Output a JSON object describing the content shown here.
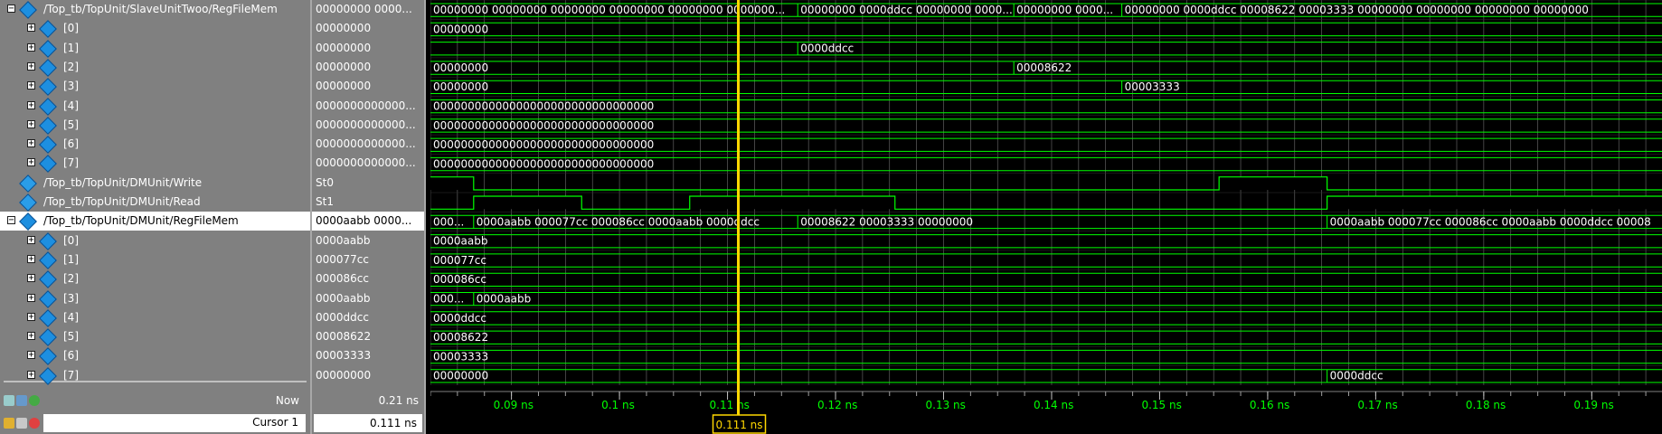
{
  "signals": [
    {
      "name": "/Top_tb/TopUnit/SlaveUnitTwoo/RegFileMem",
      "value": "00000000 0000...",
      "expand": "−",
      "indent": 0,
      "icon": "memory-diamond-icon"
    },
    {
      "name": "[0]",
      "value": "00000000",
      "expand": "+",
      "indent": 1,
      "icon": "diamond-icon"
    },
    {
      "name": "[1]",
      "value": "00000000",
      "expand": "+",
      "indent": 1,
      "icon": "diamond-icon"
    },
    {
      "name": "[2]",
      "value": "00000000",
      "expand": "+",
      "indent": 1,
      "icon": "diamond-icon"
    },
    {
      "name": "[3]",
      "value": "00000000",
      "expand": "+",
      "indent": 1,
      "icon": "diamond-icon"
    },
    {
      "name": "[4]",
      "value": "0000000000000...",
      "expand": "+",
      "indent": 1,
      "icon": "diamond-icon"
    },
    {
      "name": "[5]",
      "value": "0000000000000...",
      "expand": "+",
      "indent": 1,
      "icon": "diamond-icon"
    },
    {
      "name": "[6]",
      "value": "0000000000000...",
      "expand": "+",
      "indent": 1,
      "icon": "diamond-icon"
    },
    {
      "name": "[7]",
      "value": "0000000000000...",
      "expand": "+",
      "indent": 1,
      "icon": "diamond-icon"
    },
    {
      "name": "/Top_tb/TopUnit/DMUnit/Write",
      "value": "St0",
      "expand": "",
      "indent": 0,
      "icon": "signal-icon"
    },
    {
      "name": "/Top_tb/TopUnit/DMUnit/Read",
      "value": "St1",
      "expand": "",
      "indent": 0,
      "icon": "signal-icon"
    },
    {
      "name": "/Top_tb/TopUnit/DMUnit/RegFileMem",
      "value": "0000aabb 0000...",
      "expand": "−",
      "indent": 0,
      "icon": "memory-diamond-icon",
      "selected": true
    },
    {
      "name": "[0]",
      "value": "0000aabb",
      "expand": "+",
      "indent": 1,
      "icon": "diamond-icon"
    },
    {
      "name": "[1]",
      "value": "000077cc",
      "expand": "+",
      "indent": 1,
      "icon": "diamond-icon"
    },
    {
      "name": "[2]",
      "value": "000086cc",
      "expand": "+",
      "indent": 1,
      "icon": "diamond-icon"
    },
    {
      "name": "[3]",
      "value": "0000aabb",
      "expand": "+",
      "indent": 1,
      "icon": "diamond-icon"
    },
    {
      "name": "[4]",
      "value": "0000ddcc",
      "expand": "+",
      "indent": 1,
      "icon": "diamond-icon"
    },
    {
      "name": "[5]",
      "value": "00008622",
      "expand": "+",
      "indent": 1,
      "icon": "diamond-icon"
    },
    {
      "name": "[6]",
      "value": "00003333",
      "expand": "+",
      "indent": 1,
      "icon": "diamond-icon"
    },
    {
      "name": "[7]",
      "value": "00000000",
      "expand": "+",
      "indent": 1,
      "icon": "diamond-icon"
    }
  ],
  "status": {
    "now_label": "Now",
    "now_value": "0.21 ns",
    "cursor_label": "Cursor 1",
    "cursor_value": "0.111 ns"
  },
  "timeline": {
    "start_ns": 0.0825,
    "end_ns": 0.1965,
    "ticks_ns": [
      0.09,
      0.1,
      0.11,
      0.12,
      0.13,
      0.14,
      0.15,
      0.16,
      0.17,
      0.18,
      0.19
    ],
    "tick_labels": [
      "0.09 ns",
      "0.1 ns",
      "0.11 ns",
      "0.12 ns",
      "0.13 ns",
      "0.14 ns",
      "0.15 ns",
      "0.16 ns",
      "0.17 ns",
      "0.18 ns",
      "0.19 ns"
    ],
    "cursor_ns": 0.111,
    "cursor_label": "0.111 ns"
  },
  "waves": [
    {
      "type": "bus",
      "segments": [
        {
          "t0": 0.0825,
          "t1": 0.1165,
          "text": "00000000 00000000 00000000 00000000 00000000 0000000..."
        },
        {
          "t0": 0.1165,
          "t1": 0.1365,
          "text": "00000000 0000ddcc 00000000 0000..."
        },
        {
          "t0": 0.1365,
          "t1": 0.1465,
          "text": "00000000 0000..."
        },
        {
          "t0": 0.1465,
          "t1": 0.1965,
          "text": "00000000 0000ddcc 00008622 00003333 00000000 00000000 00000000 00000000"
        }
      ]
    },
    {
      "type": "bus",
      "segments": [
        {
          "t0": 0.0825,
          "t1": 0.1965,
          "text": "00000000"
        }
      ]
    },
    {
      "type": "bus",
      "segments": [
        {
          "t0": 0.0825,
          "t1": 0.1165,
          "text": ""
        },
        {
          "t0": 0.1165,
          "t1": 0.1965,
          "text": "0000ddcc"
        }
      ]
    },
    {
      "type": "bus",
      "segments": [
        {
          "t0": 0.0825,
          "t1": 0.1365,
          "text": "00000000"
        },
        {
          "t0": 0.1365,
          "t1": 0.1965,
          "text": "00008622"
        }
      ]
    },
    {
      "type": "bus",
      "segments": [
        {
          "t0": 0.0825,
          "t1": 0.1465,
          "text": "00000000"
        },
        {
          "t0": 0.1465,
          "t1": 0.1965,
          "text": "00003333"
        }
      ]
    },
    {
      "type": "bus",
      "segments": [
        {
          "t0": 0.0825,
          "t1": 0.1965,
          "text": "00000000000000000000000000000000"
        }
      ]
    },
    {
      "type": "bus",
      "segments": [
        {
          "t0": 0.0825,
          "t1": 0.1965,
          "text": "00000000000000000000000000000000"
        }
      ]
    },
    {
      "type": "bus",
      "segments": [
        {
          "t0": 0.0825,
          "t1": 0.1965,
          "text": "00000000000000000000000000000000"
        }
      ]
    },
    {
      "type": "bus",
      "segments": [
        {
          "t0": 0.0825,
          "t1": 0.1965,
          "text": "00000000000000000000000000000000"
        }
      ]
    },
    {
      "type": "bit",
      "transitions": [
        {
          "t": 0.0825,
          "v": 1
        },
        {
          "t": 0.0865,
          "v": 0
        },
        {
          "t": 0.1555,
          "v": 1
        },
        {
          "t": 0.1655,
          "v": 0
        }
      ]
    },
    {
      "type": "bit",
      "transitions": [
        {
          "t": 0.0825,
          "v": 0
        },
        {
          "t": 0.0865,
          "v": 1
        },
        {
          "t": 0.0965,
          "v": 0
        },
        {
          "t": 0.1065,
          "v": 1
        },
        {
          "t": 0.1255,
          "v": 0
        },
        {
          "t": 0.1655,
          "v": 1
        }
      ]
    },
    {
      "type": "bus",
      "segments": [
        {
          "t0": 0.0825,
          "t1": 0.0865,
          "text": "000..."
        },
        {
          "t0": 0.0865,
          "t1": 0.1165,
          "text": "0000aabb 000077cc 000086cc 0000aabb 0000ddcc"
        },
        {
          "t0": 0.1165,
          "t1": 0.1655,
          "text": "00008622 00003333 00000000"
        },
        {
          "t0": 0.1655,
          "t1": 0.1965,
          "text": "0000aabb 000077cc 000086cc 0000aabb 0000ddcc 00008"
        }
      ]
    },
    {
      "type": "bus",
      "segments": [
        {
          "t0": 0.0825,
          "t1": 0.1965,
          "text": "0000aabb"
        }
      ]
    },
    {
      "type": "bus",
      "segments": [
        {
          "t0": 0.0825,
          "t1": 0.1965,
          "text": "000077cc"
        }
      ]
    },
    {
      "type": "bus",
      "segments": [
        {
          "t0": 0.0825,
          "t1": 0.1965,
          "text": "000086cc"
        }
      ]
    },
    {
      "type": "bus",
      "segments": [
        {
          "t0": 0.0825,
          "t1": 0.0865,
          "text": "000..."
        },
        {
          "t0": 0.0865,
          "t1": 0.1965,
          "text": "0000aabb"
        }
      ]
    },
    {
      "type": "bus",
      "segments": [
        {
          "t0": 0.0825,
          "t1": 0.1965,
          "text": "0000ddcc"
        }
      ]
    },
    {
      "type": "bus",
      "segments": [
        {
          "t0": 0.0825,
          "t1": 0.1965,
          "text": "00008622"
        }
      ]
    },
    {
      "type": "bus",
      "segments": [
        {
          "t0": 0.0825,
          "t1": 0.1965,
          "text": "00003333"
        }
      ]
    },
    {
      "type": "bus",
      "segments": [
        {
          "t0": 0.0825,
          "t1": 0.1655,
          "text": "00000000"
        },
        {
          "t0": 0.1655,
          "t1": 0.1965,
          "text": "0000ddcc"
        }
      ]
    }
  ],
  "colors": {
    "wave": "#00ff00",
    "cursor": "#ffd700",
    "grid": "#707070",
    "ruler_text": "#00ff00"
  }
}
